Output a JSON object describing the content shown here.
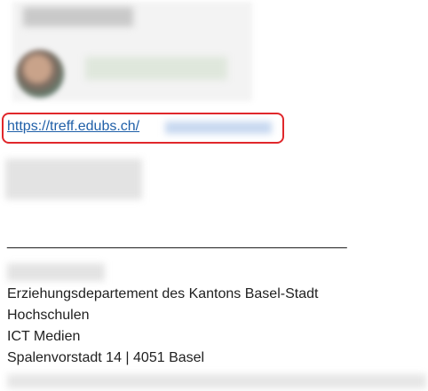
{
  "link": {
    "url_visible": "https://treff.edubs.ch/"
  },
  "separator": "___________________________________________",
  "signature": {
    "lines": [
      "Erziehungsdepartement des Kantons Basel-Stadt",
      "Hochschulen",
      "ICT Medien",
      "Spalenvorstadt 14 | 4051 Basel"
    ]
  },
  "colors": {
    "link": "#1f5fa8",
    "highlight_border": "#e0272b"
  }
}
